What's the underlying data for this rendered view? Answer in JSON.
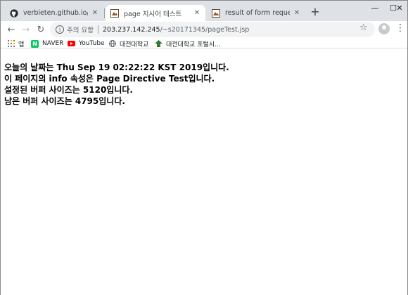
{
  "tabs": [
    {
      "title": "verbieten.github.io/pageTest",
      "icon": "github-icon"
    },
    {
      "title": "page 지시어 테스트",
      "icon": "page-favicon-icon"
    },
    {
      "title": "result of form request",
      "icon": "page-favicon-icon"
    }
  ],
  "toolbar": {
    "security_label": "주의 요함",
    "url_host": "203.237.142.245",
    "url_path": "/~s20171345/pageTest.jsp"
  },
  "bookmarks": [
    {
      "label": "앱",
      "icon": "apps-grid-icon"
    },
    {
      "label": "NAVER",
      "icon": "naver-icon"
    },
    {
      "label": "YouTube",
      "icon": "youtube-icon"
    },
    {
      "label": "대전대학교",
      "icon": "globe-icon"
    },
    {
      "label": "대전대학교 포털시...",
      "icon": "university-icon"
    }
  ],
  "page": {
    "lines": [
      "오늘의 날짜는 Thu Sep 19 02:22:22 KST 2019입니다.",
      "이 페이지의 info 속성은 Page Directive Test입니다.",
      "설정된 버퍼 사이즈는 5120입니다.",
      "남은 버퍼 사이즈는 4795입니다."
    ]
  }
}
